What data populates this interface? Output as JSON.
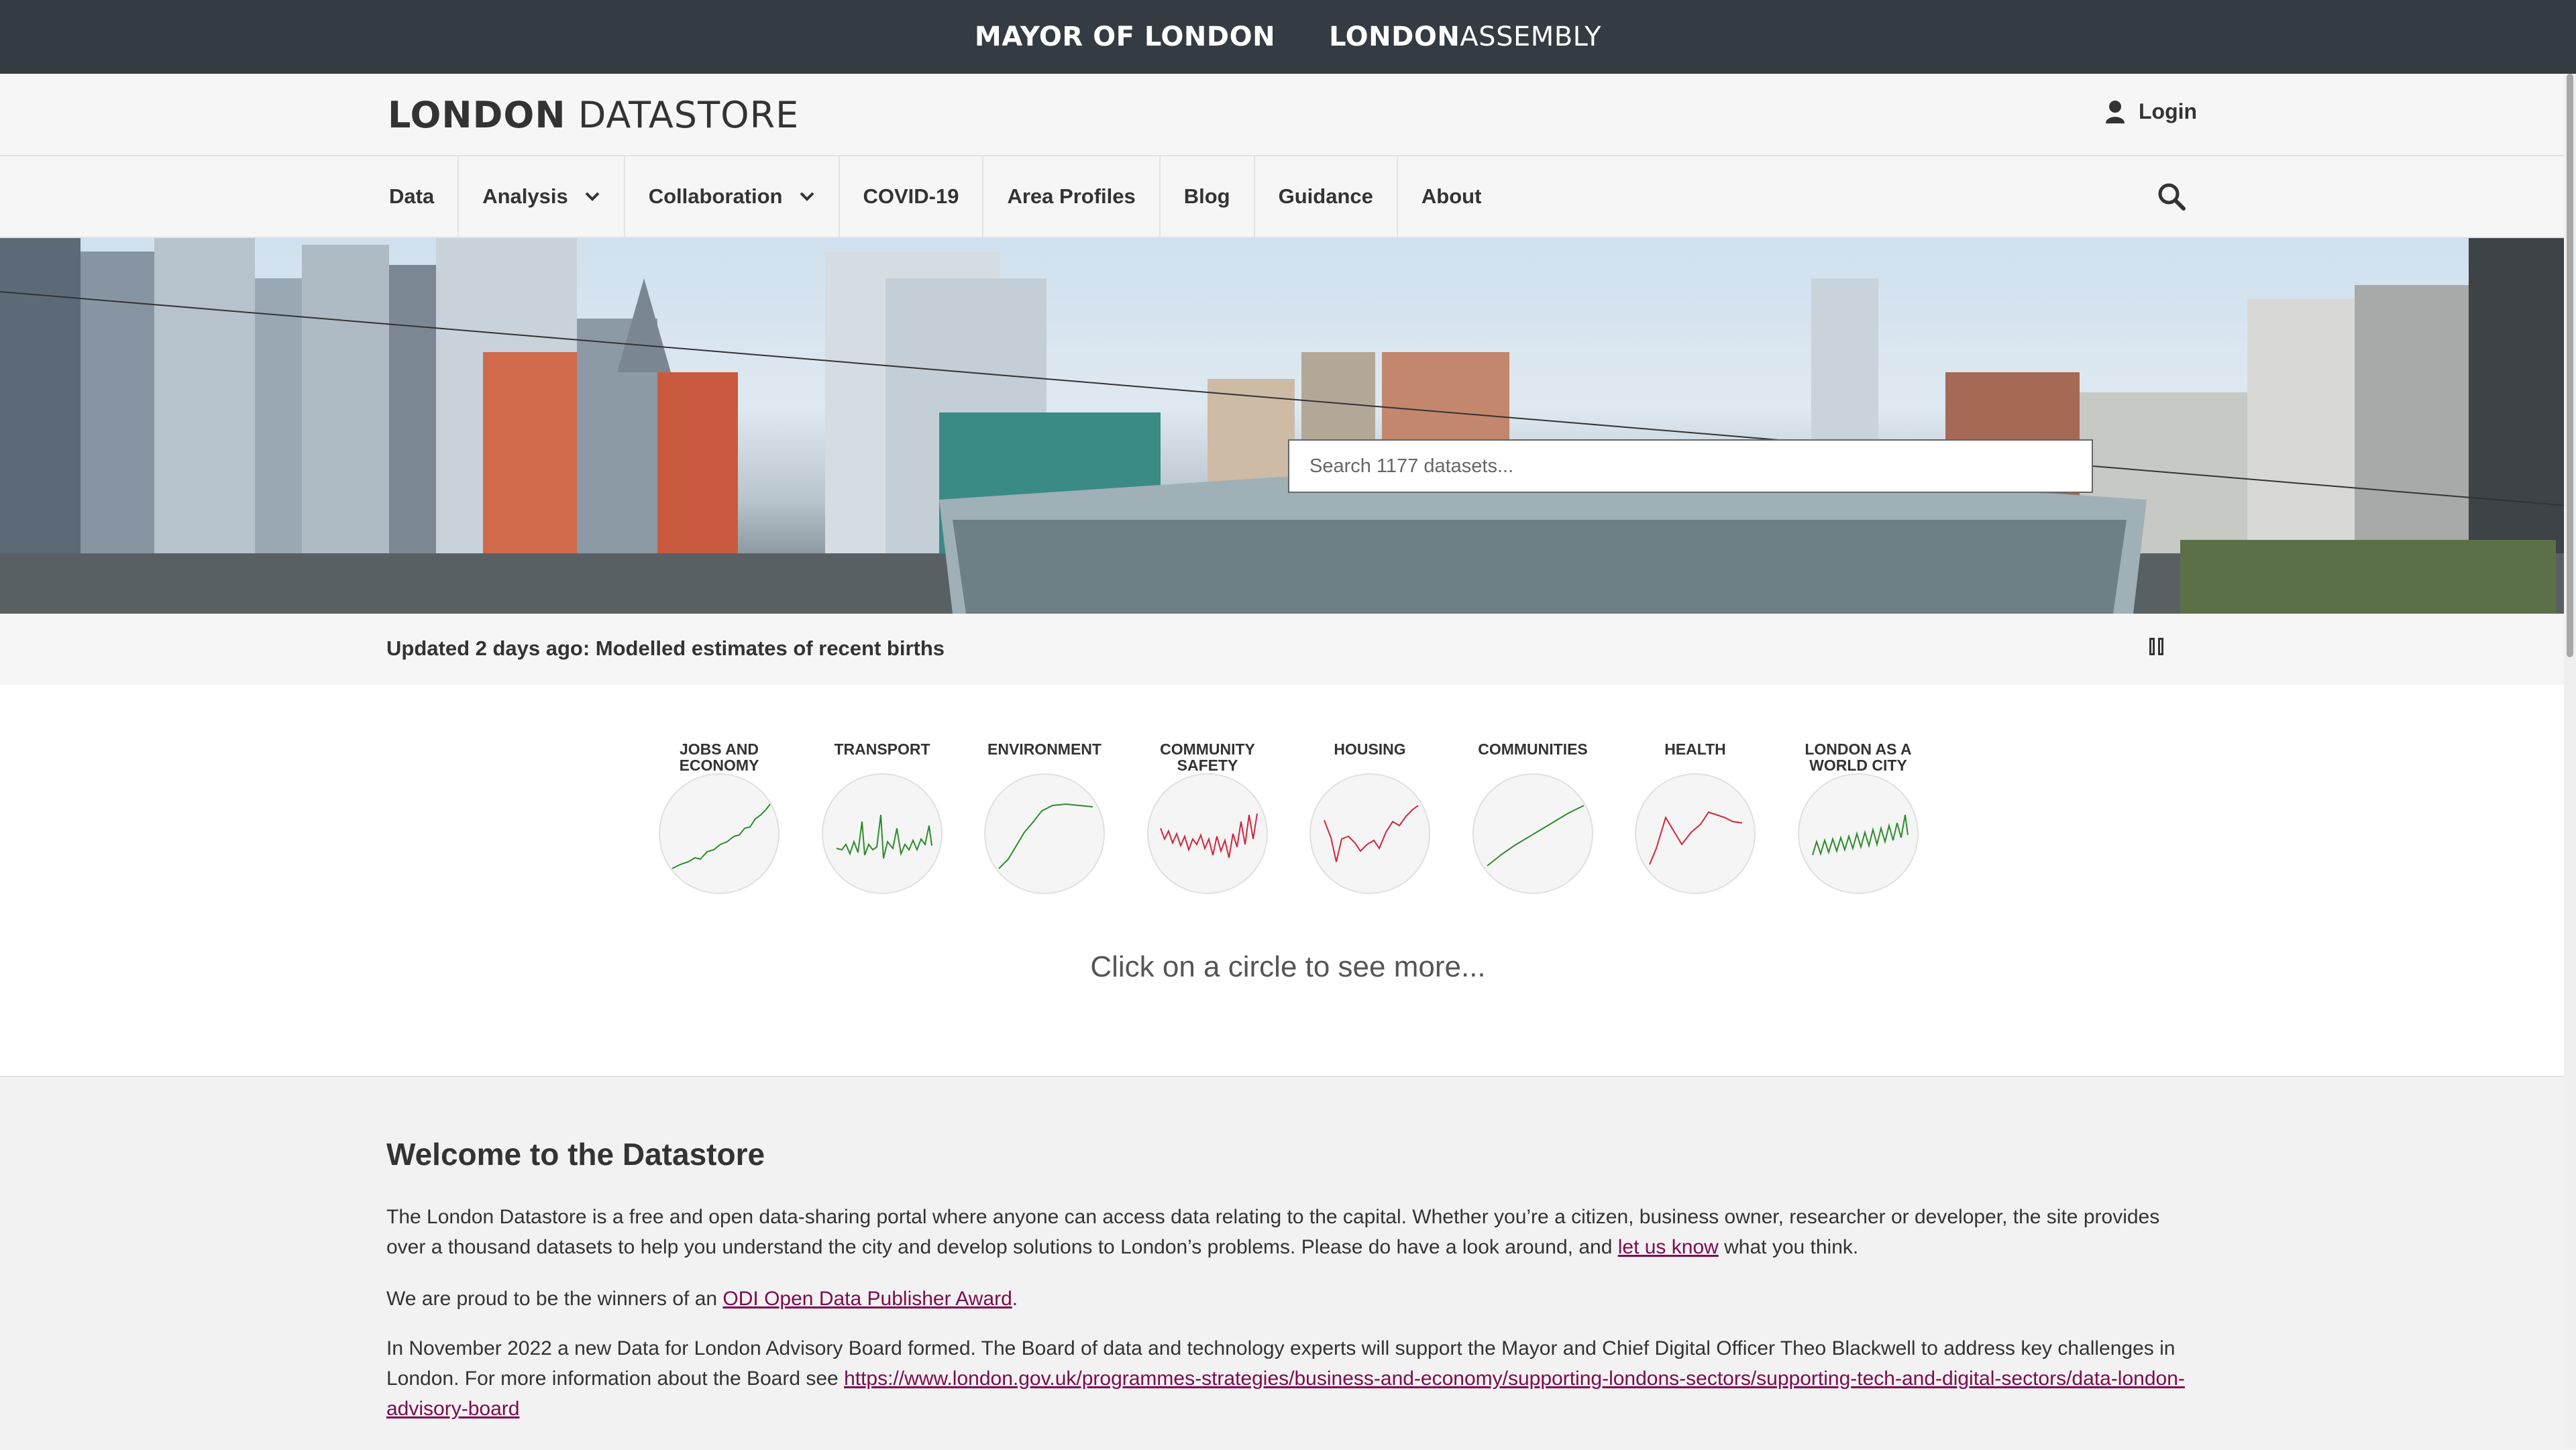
{
  "topbar": {
    "mayor": "MAYOR OF LONDON",
    "assembly_bold": "LONDON",
    "assembly_light": "ASSEMBLY"
  },
  "header": {
    "logo_bold": "LONDON",
    "logo_light": "DATASTORE",
    "login": "Login"
  },
  "nav": {
    "items": [
      "Data",
      "Analysis",
      "Collaboration",
      "COVID-19",
      "Area Profiles",
      "Blog",
      "Guidance",
      "About"
    ]
  },
  "hero": {
    "search_placeholder": "Search 1177 datasets..."
  },
  "update": {
    "text": "Updated 2 days ago: Modelled estimates of recent births"
  },
  "categories": [
    {
      "line1": "JOBS AND",
      "line2": "ECONOMY",
      "color": "#2e8b2e"
    },
    {
      "line1": "TRANSPORT",
      "line2": "",
      "color": "#2e8b2e"
    },
    {
      "line1": "ENVIRONMENT",
      "line2": "",
      "color": "#2e8b2e"
    },
    {
      "line1": "COMMUNITY",
      "line2": "SAFETY",
      "color": "#d0263d"
    },
    {
      "line1": "HOUSING",
      "line2": "",
      "color": "#d0263d"
    },
    {
      "line1": "COMMUNITIES",
      "line2": "",
      "color": "#2e8b2e"
    },
    {
      "line1": "HEALTH",
      "line2": "",
      "color": "#d0263d"
    },
    {
      "line1": "LONDON AS A",
      "line2": "WORLD CITY",
      "color": "#2e8b2e"
    }
  ],
  "hint": "Click on a circle to see more...",
  "welcome": {
    "title": "Welcome to the Datastore",
    "p1_a": "The London Datastore is  a free and open data-sharing portal  where anyone can access data relating to the capital.  Whether you’re a citizen, business owner, researcher or developer, the site provides over a thousand datasets to help you understand the city and develop solutions to London’s problems. Please do have a look around, and ",
    "p1_link": "let us know",
    "p1_b": " what you think.",
    "p2_a": "We are proud to be the winners of an ",
    "p2_link": "ODI Open Data Publisher Award",
    "p2_b": ".",
    "p3_a": "In November 2022 a new Data for London Advisory Board formed. The Board of data and technology experts will support the Mayor and Chief Digital Officer Theo Blackwell to address key challenges in London. For more information about the Board see ",
    "p3_link": "https://www.london.gov.uk/programmes-strategies/business-and-economy/supporting-londons-sectors/supporting-tech-and-digital-sectors/data-london-advisory-board"
  }
}
